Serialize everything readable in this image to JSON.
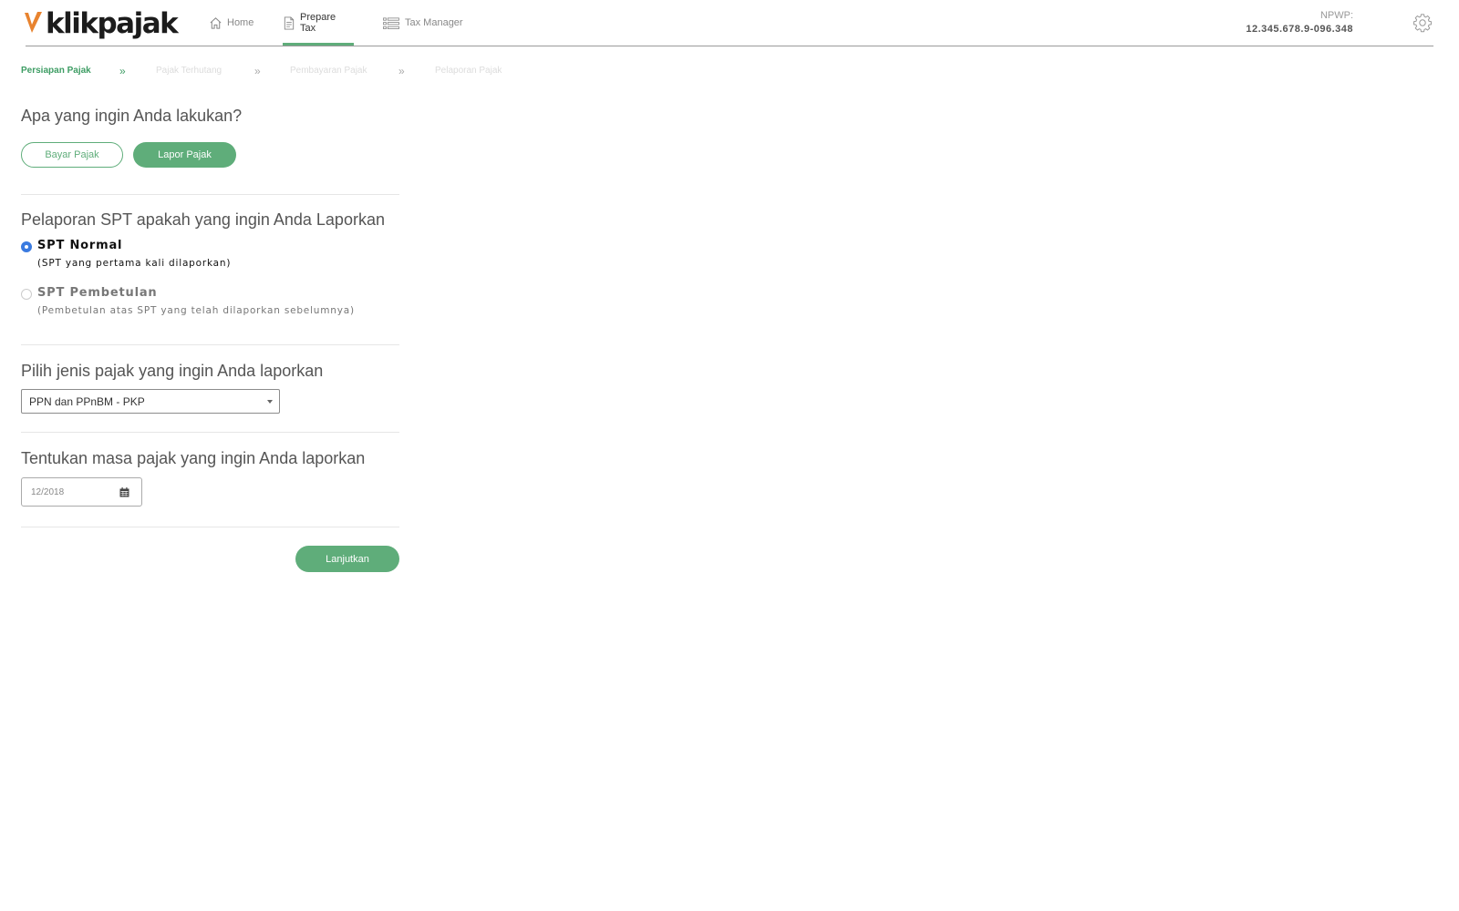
{
  "header": {
    "logo_text": "klikpajak",
    "nav": [
      {
        "label": "Home",
        "icon": "home-icon"
      },
      {
        "label": "Prepare Tax",
        "icon": "document-icon",
        "active": true
      },
      {
        "label": "Tax Manager",
        "icon": "list-icon"
      }
    ],
    "npwp_label": "NPWP:",
    "npwp_value": "12.345.678.9-096.348",
    "settings_icon": "gear-icon"
  },
  "steps": [
    {
      "label": "Persiapan Pajak",
      "active": true
    },
    {
      "label": "Pajak Terhutang",
      "active": false
    },
    {
      "label": "Pembayaran Pajak",
      "active": false
    },
    {
      "label": "Pelaporan Pajak",
      "active": false
    }
  ],
  "action": {
    "title": "Apa yang ingin Anda lakukan?",
    "options": [
      {
        "label": "Bayar Pajak",
        "selected": false
      },
      {
        "label": "Lapor Pajak",
        "selected": true
      }
    ]
  },
  "spt": {
    "title": "Pelaporan SPT apakah yang ingin Anda Laporkan",
    "options": [
      {
        "title": "SPT Normal",
        "subtitle": "(SPT yang pertama kali dilaporkan)",
        "checked": true
      },
      {
        "title": "SPT Pembetulan",
        "subtitle": "(Pembetulan atas SPT yang telah dilaporkan sebelumnya)",
        "checked": false
      }
    ]
  },
  "tax_type": {
    "title": "Pilih jenis pajak yang ingin Anda laporkan",
    "selected": "PPN dan PPnBM - PKP"
  },
  "period": {
    "title": "Tentukan masa pajak yang ingin Anda laporkan",
    "value": "12/2018"
  },
  "continue_label": "Lanjutkan",
  "colors": {
    "brand_green": "#5fad7a",
    "step_active": "#3e9d64",
    "radio_blue": "#3b7be0",
    "logo_orange": "#e8832f"
  }
}
